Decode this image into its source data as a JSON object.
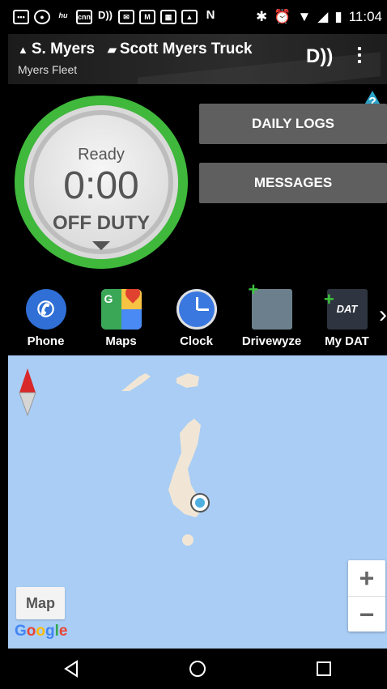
{
  "status_bar": {
    "time": "11:04",
    "notification_icons": [
      "bbm-icon",
      "chrome-icon",
      "hulu-icon",
      "cnn-icon",
      "drivewyze-icon",
      "bbm-message-icon",
      "gmail-icon",
      "calendar-icon",
      "gallery-icon",
      "n-icon"
    ],
    "system_icons": [
      "bluetooth-icon",
      "alarm-icon",
      "wifi-icon",
      "signal-icon",
      "battery-icon"
    ]
  },
  "header": {
    "driver": "S. Myers",
    "truck": "Scott Myers Truck",
    "fleet": "Myers Fleet"
  },
  "dashboard": {
    "status_label": "Ready",
    "time": "0:00",
    "duty_status": "OFF DUTY",
    "duty_ring_color": "#3fb83c",
    "daily_logs_label": "DAILY LOGS",
    "messages_label": "MESSAGES",
    "help_label": "?"
  },
  "apps": [
    {
      "label": "Phone",
      "icon": "phone-icon"
    },
    {
      "label": "Maps",
      "icon": "maps-icon"
    },
    {
      "label": "Clock",
      "icon": "clock-icon"
    },
    {
      "label": "Drivewyze",
      "icon": "drivewyze-icon"
    },
    {
      "label": "My DAT",
      "icon": "dat-icon"
    }
  ],
  "dat_icon_text": "DAT",
  "map": {
    "map_type_label": "Map",
    "zoom_in_label": "+",
    "zoom_out_label": "−",
    "google_logo": "Google",
    "water_color": "#a9cdf4",
    "land_color": "#f1e6d6"
  }
}
